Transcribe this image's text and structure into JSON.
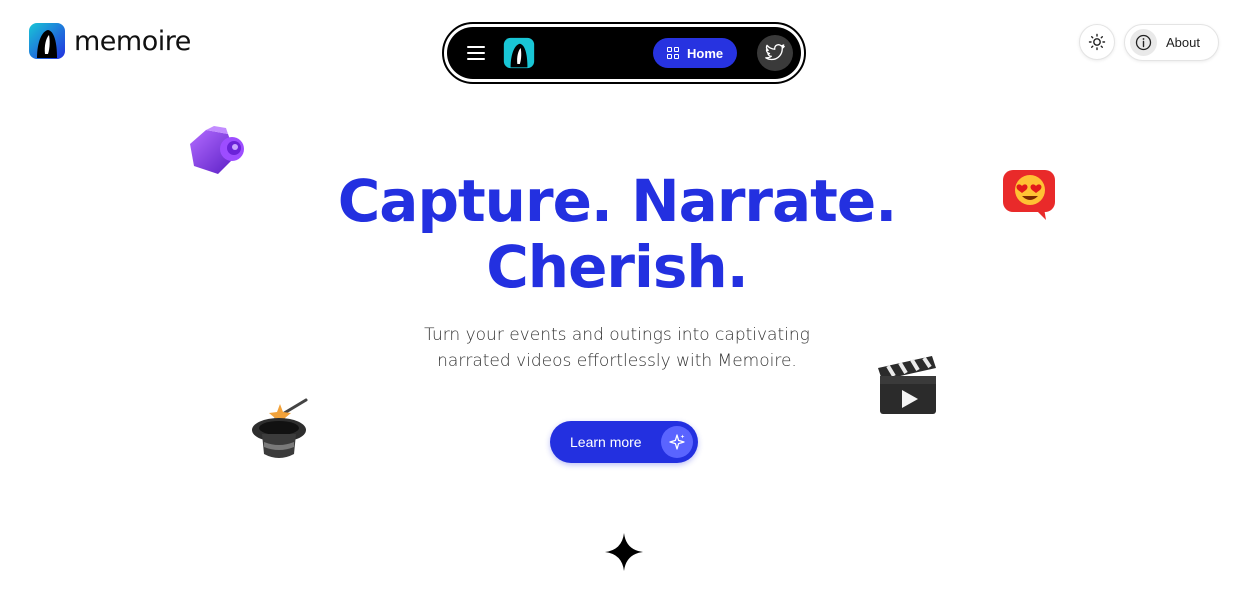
{
  "brand": {
    "name": "memoire",
    "logo_icon": "memoire-logo-icon"
  },
  "nav": {
    "menu_icon": "hamburger-menu-icon",
    "home_label": "Home",
    "home_icon": "grid-icon",
    "twitter_icon": "twitter-icon"
  },
  "controls": {
    "theme_icon": "sun-icon",
    "about_label": "About",
    "about_icon": "info-icon"
  },
  "hero": {
    "title_line1": "Capture. Narrate.",
    "title_line2": "Cherish.",
    "subtitle": "Turn your events and outings into captivating narrated videos effortlessly with Memoire.",
    "cta_label": "Learn more",
    "cta_icon": "sparkle-icon"
  },
  "decorations": [
    "camera-icon",
    "heart-eyes-emoji-icon",
    "magic-hat-icon",
    "clapperboard-icon",
    "four-point-star-icon"
  ],
  "colors": {
    "accent": "#2330e0",
    "nav_bg": "#000000",
    "sparkle_bg": "#5a64ff"
  }
}
